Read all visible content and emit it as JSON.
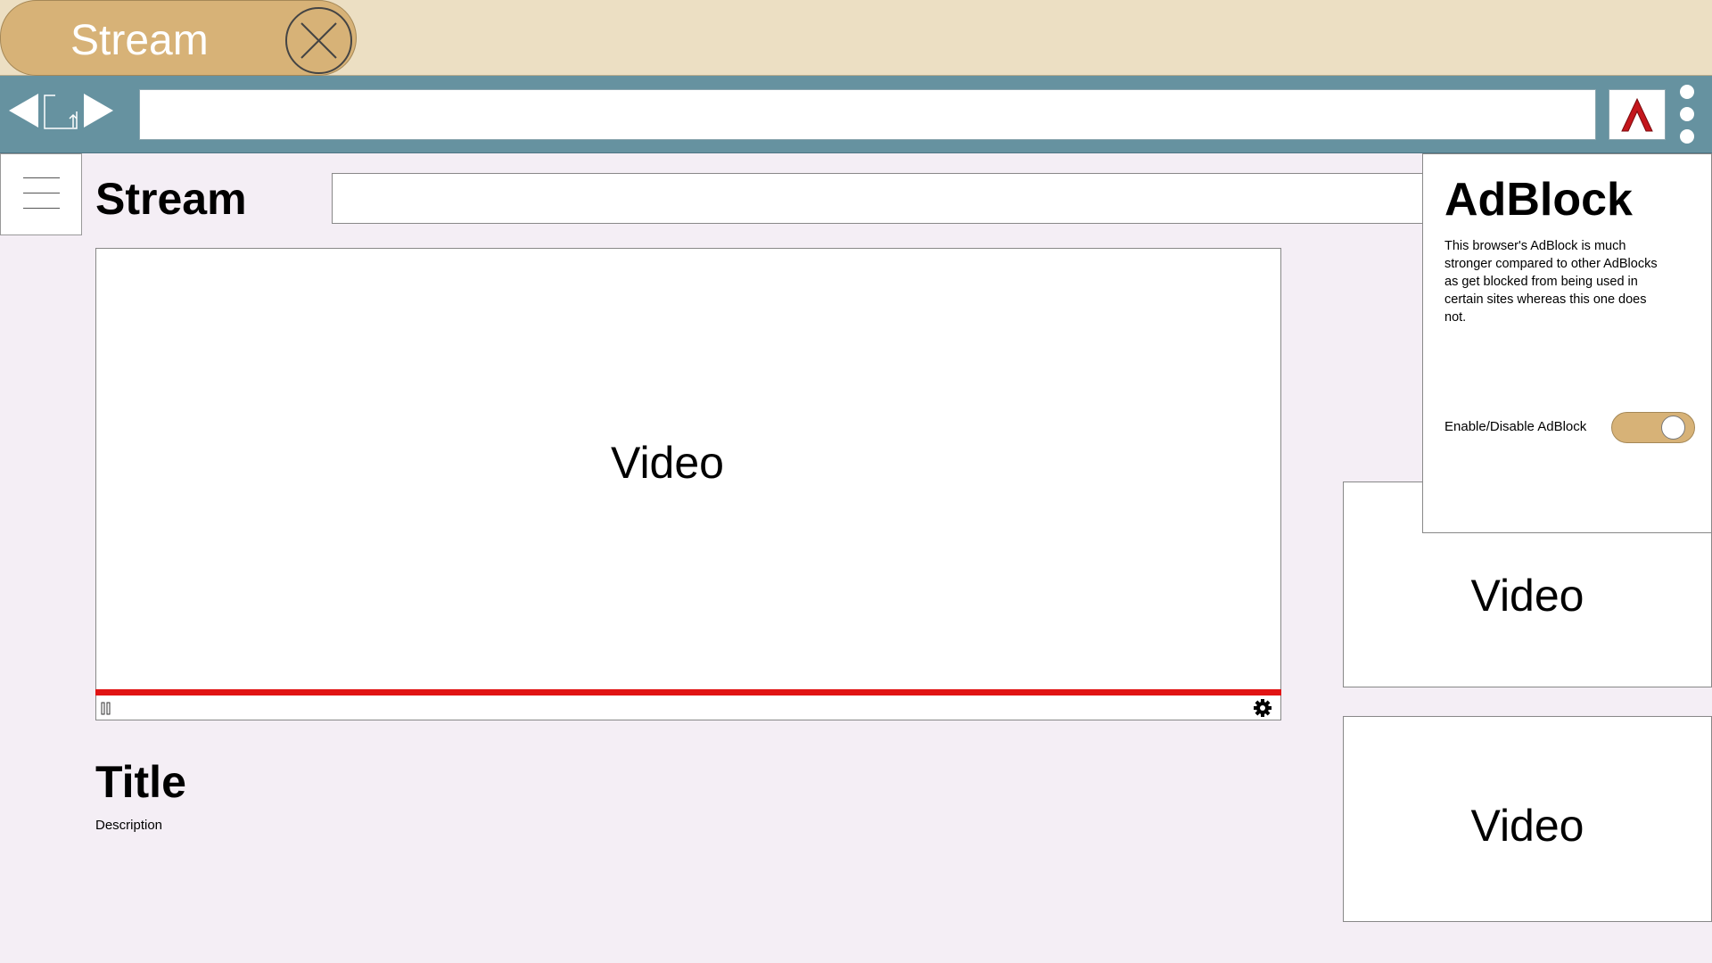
{
  "tab": {
    "title": "Stream"
  },
  "site": {
    "title": "Stream"
  },
  "main_video": {
    "label": "Video",
    "progress": 1.0
  },
  "video_info": {
    "title": "Title",
    "description": "Description"
  },
  "side_videos": [
    {
      "label": "Video"
    },
    {
      "label": "Video"
    }
  ],
  "adblock": {
    "title": "AdBlock",
    "description": "This browser's AdBlock is much stronger compared to other AdBlocks as get blocked from being used in certain sites whereas this one does not.",
    "toggle_label": "Enable/Disable AdBlock",
    "enabled": true
  },
  "colors": {
    "tab_active": "#d7b277",
    "tabstrip": "#ecdfc3",
    "toolbar": "#6692a0",
    "page_bg": "#f4eef5",
    "progress": "#e11414",
    "extension_icon": "#c4161c"
  },
  "icons": [
    "close-icon",
    "back-arrow-icon",
    "share-icon",
    "forward-arrow-icon",
    "adblock-extension-icon",
    "more-menu-icon",
    "hamburger-menu-icon",
    "pause-icon",
    "settings-gear-icon"
  ]
}
